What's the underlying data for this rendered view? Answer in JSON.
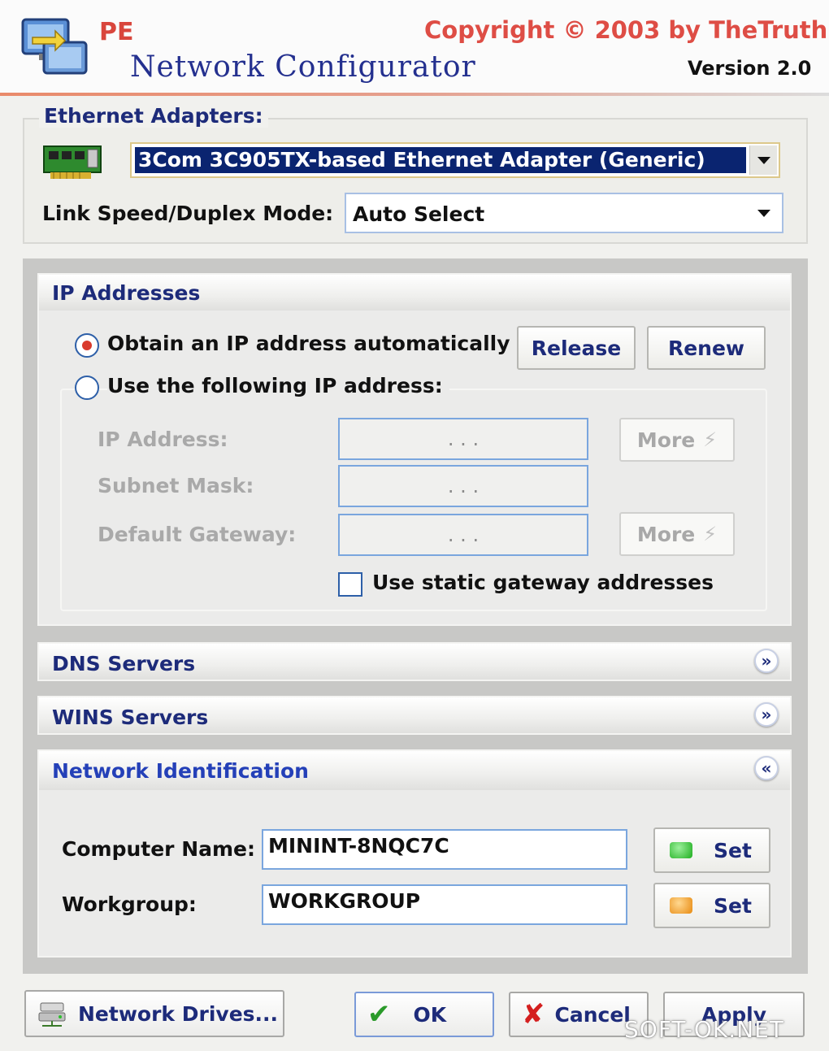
{
  "header": {
    "app_prefix": "PE",
    "app_title": "Network Configurator",
    "copyright": "Copyright © 2003 by TheTruth",
    "version": "Version 2.0"
  },
  "ethernet": {
    "group_title": "Ethernet Adapters:",
    "adapter_selected": "3Com 3C905TX-based Ethernet Adapter (Generic)",
    "link_speed_label": "Link Speed/Duplex Mode:",
    "link_speed_value": "Auto Select"
  },
  "ip": {
    "title": "IP Addresses",
    "auto_label": "Obtain an IP address automatically",
    "release_label": "Release",
    "renew_label": "Renew",
    "manual_label": "Use the following IP address:",
    "ip_address_label": "IP Address:",
    "subnet_label": "Subnet Mask:",
    "gateway_label": "Default Gateway:",
    "ip_value": ".   .   .",
    "subnet_value": ".   .   .",
    "gateway_value": ".   .   .",
    "more_label": "More",
    "static_gateway_label": "Use static gateway addresses",
    "auto_selected": true,
    "static_gateway_checked": false
  },
  "dns": {
    "title": "DNS Servers"
  },
  "wins": {
    "title": "WINS Servers"
  },
  "netid": {
    "title": "Network Identification",
    "computer_name_label": "Computer Name:",
    "computer_name_value": "MININT-8NQC7C",
    "workgroup_label": "Workgroup:",
    "workgroup_value": "WORKGROUP",
    "set_label": "Set"
  },
  "footer": {
    "network_drives_label": "Network Drives...",
    "ok_label": "OK",
    "cancel_label": "Cancel",
    "apply_label": "Apply",
    "watermark": "SOFT-OK.NET"
  },
  "colors": {
    "accent": "#1d2b7a",
    "title_red": "#de4d45",
    "status_green": "#2fbf2f",
    "status_orange": "#f0a020"
  }
}
